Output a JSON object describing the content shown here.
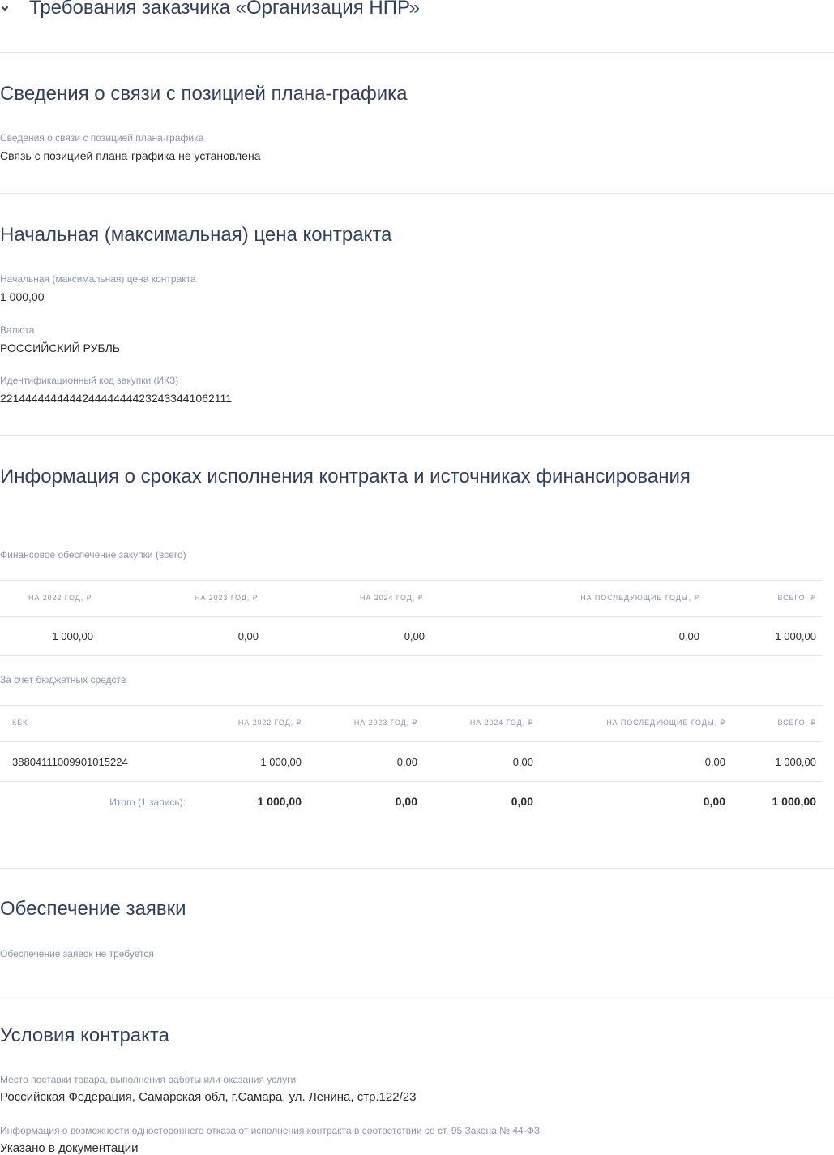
{
  "header": {
    "collapse_icon": "chevron-down-icon",
    "title": "Требования заказчика «Организация НПР»"
  },
  "plan_link": {
    "heading": "Сведения о связи с позицией плана-графика",
    "label": "Сведения о связи с позицией плана-графика",
    "value": "Связь с позицией плана-графика не установлена"
  },
  "price": {
    "heading": "Начальная (максимальная) цена контракта",
    "fields": [
      {
        "label": "Начальная (максимальная) цена контракта",
        "value": "1 000,00"
      },
      {
        "label": "Валюта",
        "value": "РОССИЙСКИЙ РУБЛЬ"
      },
      {
        "label": "Идентификационный код закупки (ИКЗ)",
        "value": "221444444444424444444423243344106211 1"
      }
    ]
  },
  "financing": {
    "heading": "Информация о сроках исполнения контракта и источниках финансирования",
    "total_label": "Финансовое обеспечение закупки (всего)",
    "total_table": {
      "headers": [
        "НА 2022 ГОД, ₽",
        "НА 2023 ГОД, ₽",
        "НА 2024 ГОД, ₽",
        "НА ПОСЛЕДУЮЩИЕ ГОДЫ, ₽",
        "ВСЕГО, ₽"
      ],
      "row": [
        "1 000,00",
        "0,00",
        "0,00",
        "0,00",
        "1 000,00"
      ]
    },
    "budget_label": "За счет бюджетных средств",
    "budget_table": {
      "headers": [
        "КБК",
        "НА 2022 ГОД, ₽",
        "НА 2023 ГОД, ₽",
        "НА 2024 ГОД, ₽",
        "НА ПОСЛЕДУЮЩИЕ ГОДЫ, ₽",
        "ВСЕГО, ₽"
      ],
      "row": [
        "38804111009901015224",
        "1 000,00",
        "0,00",
        "0,00",
        "0,00",
        "1 000,00"
      ],
      "total_label": "Итого (1 запись):",
      "total_row": [
        "1 000,00",
        "0,00",
        "0,00",
        "0,00",
        "1 000,00"
      ]
    }
  },
  "guarantee": {
    "heading": "Обеспечение заявки",
    "note": "Обеспечение заявок не требуется"
  },
  "conditions": {
    "heading": "Условия контракта",
    "fields": [
      {
        "label": "Место поставки товара, выполнения работы или оказания услуги",
        "value": "Российская Федерация, Самарская обл, г.Самара, ул. Ленина, стр.122/23"
      },
      {
        "label": "Информация о возможности одностороннего отказа от исполнения контракта в соответствии со ст. 95 Закона № 44-ФЗ",
        "value": "Указано в документации"
      }
    ]
  }
}
